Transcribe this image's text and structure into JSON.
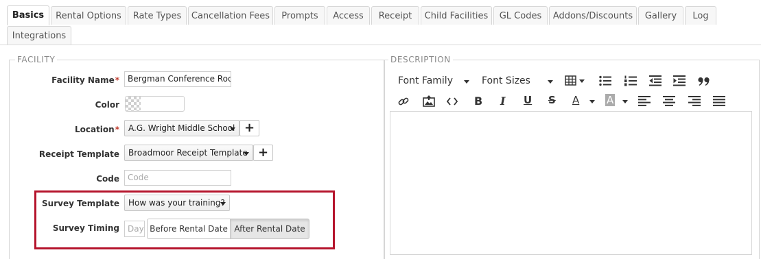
{
  "tabs": [
    {
      "label": "Basics",
      "active": true
    },
    {
      "label": "Rental Options"
    },
    {
      "label": "Rate Types"
    },
    {
      "label": "Cancellation Fees"
    },
    {
      "label": "Prompts"
    },
    {
      "label": "Access"
    },
    {
      "label": "Receipt"
    },
    {
      "label": "Child Facilities"
    },
    {
      "label": "GL Codes"
    },
    {
      "label": "Addons/Discounts"
    },
    {
      "label": "Gallery"
    },
    {
      "label": "Log"
    },
    {
      "label": "Integrations"
    }
  ],
  "facility": {
    "legend": "FACILITY",
    "name_label": "Facility Name",
    "name_value": "Bergman Conference Room",
    "color_label": "Color",
    "location_label": "Location",
    "location_value": "A.G. Wright Middle School",
    "receipt_label": "Receipt Template",
    "receipt_value": "Broadmoor Receipt Template",
    "code_label": "Code",
    "code_placeholder": "Code",
    "survey_label": "Survey Template",
    "survey_value": "How was your training?",
    "timing_label": "Survey Timing",
    "timing_placeholder": "Day",
    "timing_before": "Before Rental Date",
    "timing_after": "After Rental Date",
    "timing_selected": "After Rental Date",
    "required_mark": "*",
    "add_symbol": "+"
  },
  "description": {
    "legend": "DESCRIPTION",
    "font_family": "Font Family",
    "font_sizes": "Font Sizes",
    "bold": "B",
    "italic": "I",
    "underline": "U",
    "strike": "S",
    "text_color": "A",
    "bg_color": "A",
    "content": ""
  },
  "colors": {
    "highlight": "#b5142c",
    "required": "#c0392b"
  }
}
